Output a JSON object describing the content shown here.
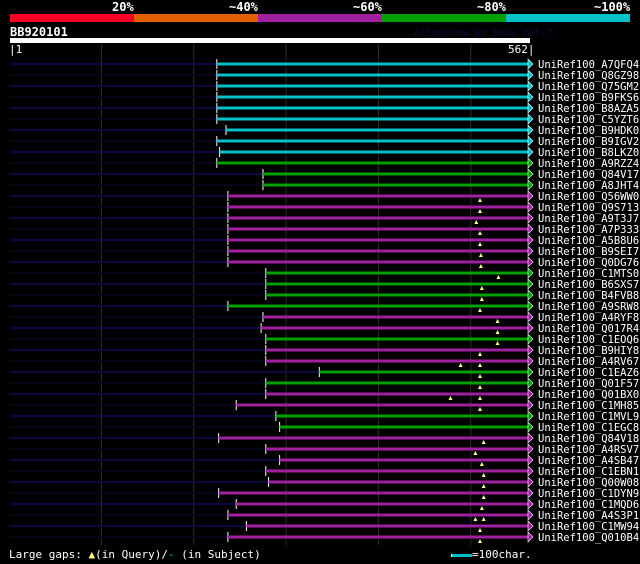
{
  "legend": {
    "labels": [
      "20%",
      "~40%",
      "~60%",
      "~80%",
      "~100%"
    ],
    "colors": [
      "#ff0022",
      "#e06000",
      "#a020a0",
      "#00a000",
      "#00c0c8"
    ]
  },
  "query": {
    "name": "BB920101",
    "version": "AlignView.pm Beta rel.7",
    "start": "|1",
    "end": "562|",
    "length": 562
  },
  "hits": [
    {
      "id": "UniRef100_A7QFQ4",
      "c": 4,
      "s": 225,
      "g": []
    },
    {
      "id": "UniRef100_Q8GZ98",
      "c": 4,
      "s": 225,
      "g": []
    },
    {
      "id": "UniRef100_Q75GM2",
      "c": 4,
      "s": 225,
      "g": []
    },
    {
      "id": "UniRef100_B9FKS6",
      "c": 4,
      "s": 225,
      "g": []
    },
    {
      "id": "UniRef100_B8AZA5",
      "c": 4,
      "s": 225,
      "g": []
    },
    {
      "id": "UniRef100_C5YZT6",
      "c": 4,
      "s": 225,
      "g": []
    },
    {
      "id": "UniRef100_B9HDK0",
      "c": 4,
      "s": 235,
      "g": []
    },
    {
      "id": "UniRef100_B9IGV2",
      "c": 4,
      "s": 225,
      "g": []
    },
    {
      "id": "UniRef100_B8LKZ0",
      "c": 4,
      "s": 228,
      "g": []
    },
    {
      "id": "UniRef100_A9RZZ4",
      "c": 3,
      "s": 225,
      "g": []
    },
    {
      "id": "UniRef100_Q84V17",
      "c": 3,
      "s": 275,
      "g": []
    },
    {
      "id": "UniRef100_A8JHT4",
      "c": 3,
      "s": 275,
      "g": []
    },
    {
      "id": "UniRef100_Q56WW0",
      "c": 2,
      "s": 237,
      "g": [
        510
      ]
    },
    {
      "id": "UniRef100_Q9S713",
      "c": 2,
      "s": 237,
      "g": [
        510
      ]
    },
    {
      "id": "UniRef100_A9T3J7",
      "c": 2,
      "s": 237,
      "g": [
        506
      ]
    },
    {
      "id": "UniRef100_A7P333",
      "c": 2,
      "s": 237,
      "g": [
        510
      ]
    },
    {
      "id": "UniRef100_A5B8U6",
      "c": 2,
      "s": 237,
      "g": [
        510
      ]
    },
    {
      "id": "UniRef100_B9SEI7",
      "c": 2,
      "s": 237,
      "g": [
        511
      ]
    },
    {
      "id": "UniRef100_Q0DG76",
      "c": 2,
      "s": 237,
      "g": [
        511
      ]
    },
    {
      "id": "UniRef100_C1MTS0",
      "c": 3,
      "s": 278,
      "g": [
        530
      ]
    },
    {
      "id": "UniRef100_B6SXS7",
      "c": 3,
      "s": 278,
      "g": [
        512
      ]
    },
    {
      "id": "UniRef100_B4FVB8",
      "c": 3,
      "s": 278,
      "g": [
        512
      ]
    },
    {
      "id": "UniRef100_A9SRW8",
      "c": 3,
      "s": 237,
      "g": [
        510
      ]
    },
    {
      "id": "UniRef100_A4RYF8",
      "c": 2,
      "s": 275,
      "g": [
        529
      ]
    },
    {
      "id": "UniRef100_Q017R4",
      "c": 2,
      "s": 273,
      "g": [
        529
      ]
    },
    {
      "id": "UniRef100_C1EOQ6",
      "c": 3,
      "s": 278,
      "g": [
        529
      ]
    },
    {
      "id": "UniRef100_B9HIY8",
      "c": 2,
      "s": 278,
      "g": [
        510
      ]
    },
    {
      "id": "UniRef100_A4RV67",
      "c": 2,
      "s": 278,
      "g": [
        489,
        510
      ]
    },
    {
      "id": "UniRef100_C1EAZ6",
      "c": 3,
      "s": 336,
      "g": [
        510
      ]
    },
    {
      "id": "UniRef100_Q01F57",
      "c": 3,
      "s": 278,
      "g": [
        510
      ]
    },
    {
      "id": "UniRef100_Q01BX0",
      "c": 2,
      "s": 278,
      "g": [
        478,
        510
      ]
    },
    {
      "id": "UniRef100_C1MH85",
      "c": 2,
      "s": 246,
      "g": [
        510
      ]
    },
    {
      "id": "UniRef100_C1MVL9",
      "c": 3,
      "s": 289,
      "g": []
    },
    {
      "id": "UniRef100_C1EGC8",
      "c": 3,
      "s": 293,
      "g": []
    },
    {
      "id": "UniRef100_Q84V18",
      "c": 2,
      "s": 227,
      "g": [
        514
      ]
    },
    {
      "id": "UniRef100_A4RSV7",
      "c": 2,
      "s": 278,
      "g": [
        505
      ]
    },
    {
      "id": "UniRef100_A4SB47",
      "c": 2,
      "s": 293,
      "g": [
        512
      ]
    },
    {
      "id": "UniRef100_C1EBN1",
      "c": 2,
      "s": 278,
      "g": [
        514
      ]
    },
    {
      "id": "UniRef100_Q00W08",
      "c": 2,
      "s": 281,
      "g": [
        514
      ]
    },
    {
      "id": "UniRef100_C1DYN9",
      "c": 2,
      "s": 227,
      "g": [
        514
      ]
    },
    {
      "id": "UniRef100_C1MQD6",
      "c": 2,
      "s": 246,
      "g": [
        512
      ]
    },
    {
      "id": "UniRef100_A4S3P1",
      "c": 2,
      "s": 237,
      "g": [
        505,
        514
      ]
    },
    {
      "id": "UniRef100_C1MW94",
      "c": 2,
      "s": 257,
      "g": [
        510
      ]
    },
    {
      "id": "UniRef100_Q010B4",
      "c": 2,
      "s": 237,
      "g": [
        510
      ]
    }
  ],
  "footer": {
    "gaps_label": "Large gaps:",
    "query_gap": "(in Query)/",
    "subject_gap": "(in Subject)",
    "scale": "=100char."
  }
}
